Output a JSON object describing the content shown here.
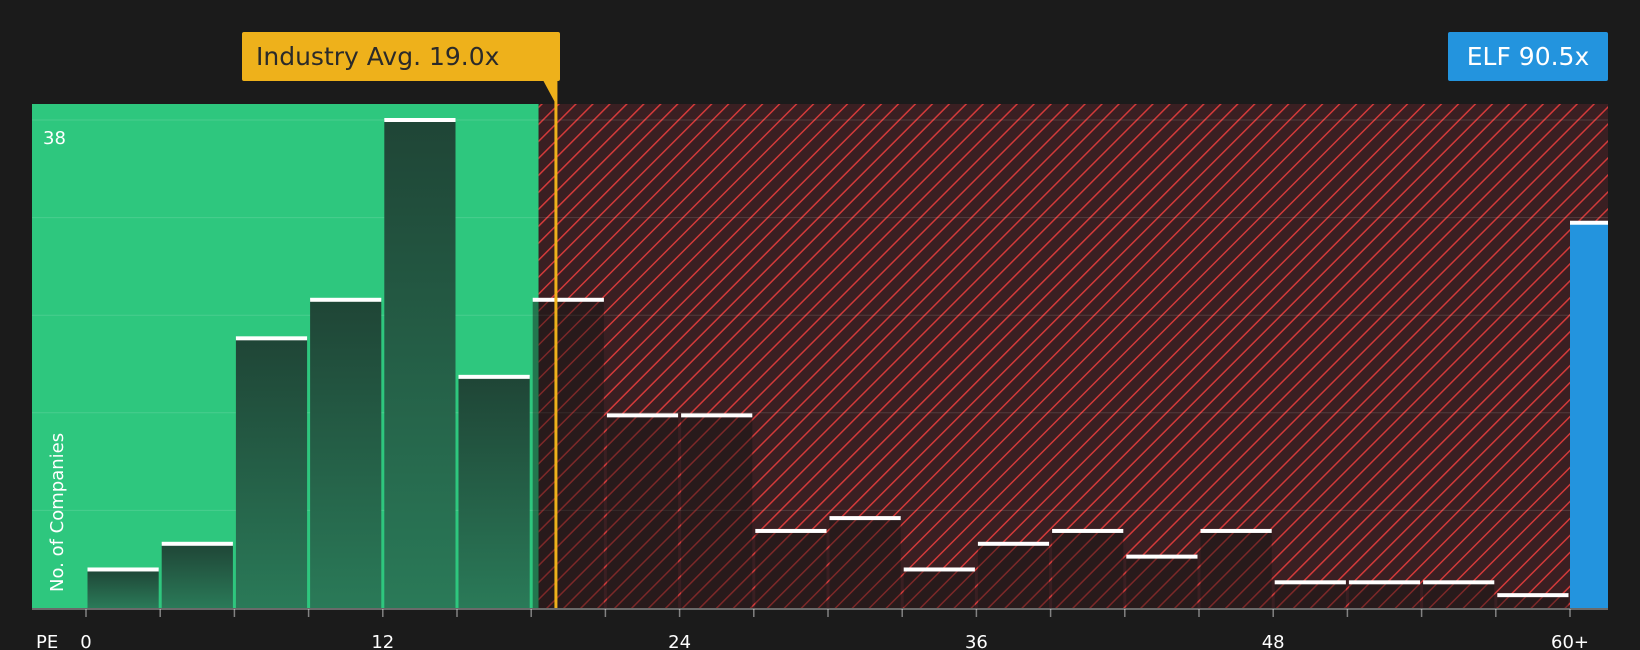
{
  "chart_data": {
    "type": "bar",
    "x_axis_label": "PE",
    "y_axis_label": "No. of Companies",
    "y_max_label": "38",
    "ylim": [
      0,
      41
    ],
    "x_ticks": [
      "0",
      "12",
      "24",
      "36",
      "48",
      "60+"
    ],
    "bins": [
      {
        "start": 0,
        "end": 3,
        "count": 3
      },
      {
        "start": 3,
        "end": 6,
        "count": 5
      },
      {
        "start": 6,
        "end": 9,
        "count": 21
      },
      {
        "start": 9,
        "end": 12,
        "count": 24
      },
      {
        "start": 12,
        "end": 15,
        "count": 38
      },
      {
        "start": 15,
        "end": 18,
        "count": 18
      },
      {
        "start": 18,
        "end": 21,
        "count": 24
      },
      {
        "start": 21,
        "end": 24,
        "count": 15
      },
      {
        "start": 24,
        "end": 27,
        "count": 15
      },
      {
        "start": 27,
        "end": 30,
        "count": 6
      },
      {
        "start": 30,
        "end": 33,
        "count": 7
      },
      {
        "start": 33,
        "end": 36,
        "count": 3
      },
      {
        "start": 36,
        "end": 39,
        "count": 5
      },
      {
        "start": 39,
        "end": 42,
        "count": 6
      },
      {
        "start": 42,
        "end": 45,
        "count": 4
      },
      {
        "start": 45,
        "end": 48,
        "count": 6
      },
      {
        "start": 48,
        "end": 51,
        "count": 2
      },
      {
        "start": 51,
        "end": 54,
        "count": 2
      },
      {
        "start": 54,
        "end": 57,
        "count": 2
      },
      {
        "start": 57,
        "end": 60,
        "count": 1
      }
    ],
    "industry_average": {
      "label": "Industry Avg. 19.0x",
      "value": 19.0
    },
    "company": {
      "label": "ELF 90.5x",
      "ticker": "ELF",
      "value": 90.5,
      "bar_level": 30
    },
    "fair_zone_end": 18.3,
    "colors": {
      "background": "#1b1b1b",
      "fair_zone": "#2ec77e",
      "overvalued_zone": "#3a1f22",
      "hatch": "#d23a3a",
      "bar_top": "#ffffff",
      "industry": "#eeb11b",
      "company": "#2394de"
    }
  }
}
